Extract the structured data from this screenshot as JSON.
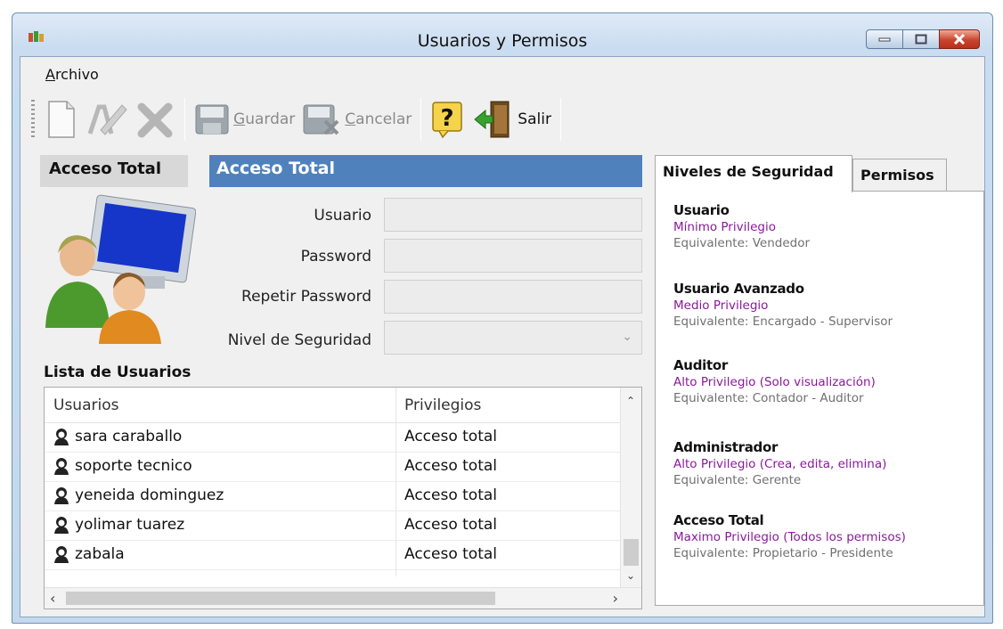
{
  "window": {
    "title": "Usuarios y Permisos"
  },
  "menu": {
    "archivo_first": "A",
    "archivo_rest": "rchivo"
  },
  "toolbar": {
    "guardar_first": "G",
    "guardar_rest": "uardar",
    "cancelar_first": "C",
    "cancelar_rest": "ancelar",
    "salir": "Salir"
  },
  "header": {
    "left": "Acceso Total",
    "right": "Acceso Total"
  },
  "form": {
    "usuario_label": "Usuario",
    "password_label": "Password",
    "repetir_label": "Repetir Password",
    "nivel_label": "Nivel de Seguridad",
    "usuario_value": "",
    "password_value": "",
    "repetir_value": "",
    "nivel_value": ""
  },
  "list": {
    "title": "Lista de Usuarios",
    "columns": [
      "Usuarios",
      "Privilegios"
    ],
    "rows": [
      {
        "name": "sara caraballo",
        "priv": "Acceso total"
      },
      {
        "name": "soporte tecnico",
        "priv": "Acceso total"
      },
      {
        "name": "yeneida dominguez",
        "priv": "Acceso total"
      },
      {
        "name": "yolimar tuarez",
        "priv": "Acceso total"
      },
      {
        "name": "zabala",
        "priv": "Acceso total"
      }
    ]
  },
  "tabs": [
    "Niveles de Seguridad",
    "Permisos"
  ],
  "levels": [
    {
      "name": "Usuario",
      "priv": "Mínimo Privilegio",
      "eq": "Equivalente:  Vendedor"
    },
    {
      "name": "Usuario Avanzado",
      "priv": "Medio Privilegio",
      "eq": "Equivalente:  Encargado - Supervisor"
    },
    {
      "name": "Auditor",
      "priv": "Alto Privilegio (Solo visualización)",
      "eq": "Equivalente:  Contador - Auditor"
    },
    {
      "name": "Administrador",
      "priv": "Alto Privilegio (Crea, edita, elimina)",
      "eq": "Equivalente:  Gerente"
    },
    {
      "name": "Acceso Total",
      "priv": "Maximo Privilegio (Todos los permisos)",
      "eq": "Equivalente:  Propietario - Presidente"
    }
  ],
  "icons": [
    "app-icon",
    "new-document-icon",
    "edit-icon",
    "delete-icon",
    "save-icon",
    "cancel-icon",
    "help-icon",
    "exit-door-icon",
    "users-computer-icon",
    "user-icon"
  ],
  "colors": {
    "accent": "#4f81bd",
    "privilege_text": "#8a1a9a",
    "close_button": "#c9442d"
  }
}
